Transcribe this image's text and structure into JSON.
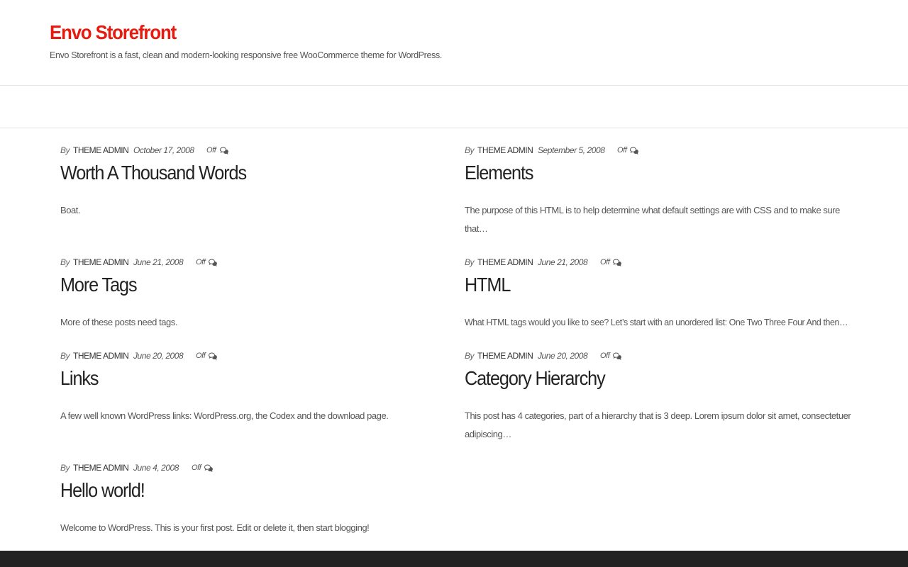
{
  "site": {
    "title": "Envo Storefront",
    "description": "Envo Storefront is a fast, clean and modern-looking responsive free WooCommerce theme for WordPress.",
    "accent_color": "#e8190e"
  },
  "posts": [
    {
      "by": "By",
      "author": "THEME ADMIN",
      "date": "October 17, 2008",
      "comments": "Off",
      "comment_icon": "comments-icon",
      "title": "Worth A Thousand Words",
      "excerpt": "Boat."
    },
    {
      "by": "By",
      "author": "THEME ADMIN",
      "date": "September 5, 2008",
      "comments": "Off",
      "comment_icon": "comments-icon",
      "title": "Elements",
      "excerpt": "The purpose of this HTML is to help determine what default settings are with CSS and to make sure that…"
    },
    {
      "by": "By",
      "author": "THEME ADMIN",
      "date": "June 21, 2008",
      "comments": "Off",
      "comment_icon": "comments-icon",
      "title": "More Tags",
      "excerpt": "More of these posts need tags."
    },
    {
      "by": "By",
      "author": "THEME ADMIN",
      "date": "June 21, 2008",
      "comments": "Off",
      "comment_icon": "comments-icon",
      "title": "HTML",
      "excerpt": "What HTML tags would you like to see? Let’s start with an unordered list: One Two Three Four And then…"
    },
    {
      "by": "By",
      "author": "THEME ADMIN",
      "date": "June 20, 2008",
      "comments": "Off",
      "comment_icon": "comments-icon",
      "title": "Links",
      "excerpt": "A few well known WordPress links: WordPress.org, the Codex and the download page."
    },
    {
      "by": "By",
      "author": "THEME ADMIN",
      "date": "June 20, 2008",
      "comments": "Off",
      "comment_icon": "comments-icon",
      "title": "Category Hierarchy",
      "excerpt": "This post has 4 categories, part of a hierarchy that is 3 deep. Lorem ipsum dolor sit amet, consectetuer adipiscing…"
    },
    {
      "by": "By",
      "author": "THEME ADMIN",
      "date": "June 4, 2008",
      "comments": "Off",
      "comment_icon": "comments-icon",
      "title": "Hello world!",
      "excerpt": "Welcome to WordPress. This is your first post. Edit or delete it, then start blogging!"
    }
  ],
  "footer": {
    "background": "#222222"
  }
}
